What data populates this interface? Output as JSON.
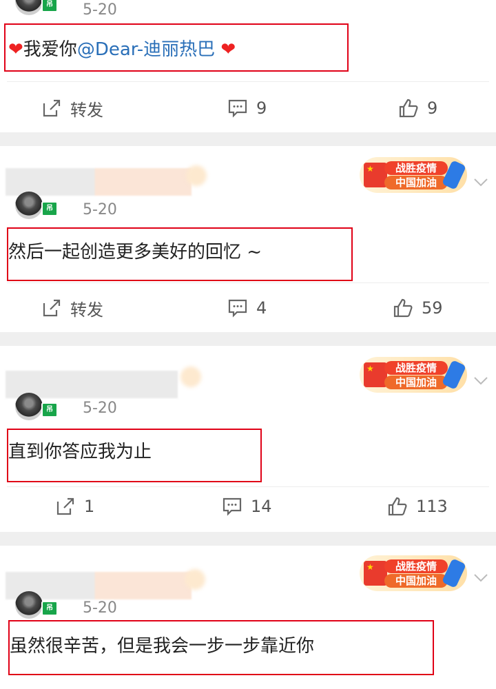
{
  "posts": [
    {
      "date": "5-20",
      "content_parts": {
        "heart_left": "❤",
        "text": "我爱你",
        "mention": "@Dear-迪丽热巴",
        "heart_right": " ❤"
      },
      "repost": "转发",
      "comments": "9",
      "likes": "9"
    },
    {
      "date": "5-20",
      "badge": {
        "line1": "战胜疫情",
        "line2": "中国加油"
      },
      "content": "然后一起创造更多美好的回忆 ~",
      "repost": "转发",
      "comments": "4",
      "likes": "59"
    },
    {
      "date": "5-20",
      "badge": {
        "line1": "战胜疫情",
        "line2": "中国加油"
      },
      "content": "直到你答应我为止",
      "repost": "1",
      "comments": "14",
      "likes": "113"
    },
    {
      "date": "5-20",
      "badge": {
        "line1": "战胜疫情",
        "line2": "中国加油"
      },
      "content": "虽然很辛苦，但是我会一步一步靠近你"
    }
  ],
  "vip_label": "吊",
  "colors": {
    "highlight_box": "#e00016",
    "mention": "#2a6fb8",
    "separator": "#efefef"
  }
}
